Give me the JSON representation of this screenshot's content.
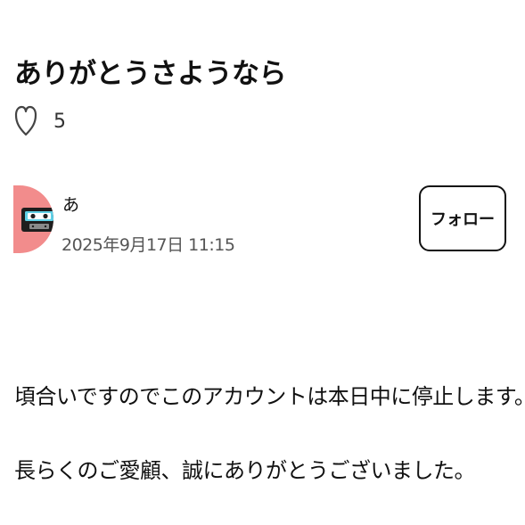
{
  "post": {
    "title": "ありがとうさようなら",
    "like_count": "5",
    "body": [
      "頃合いですのでこのアカウントは本日中に停止します。",
      "長らくのご愛顧、誠にありがとうございました。"
    ]
  },
  "author": {
    "name": "あ",
    "date": "2025年9月17日 11:15",
    "avatar_color": "#f28c8c",
    "avatar_icon": "cassette-tape-icon"
  },
  "actions": {
    "follow_label": "フォロー",
    "like_icon": "heart-outline-icon"
  }
}
